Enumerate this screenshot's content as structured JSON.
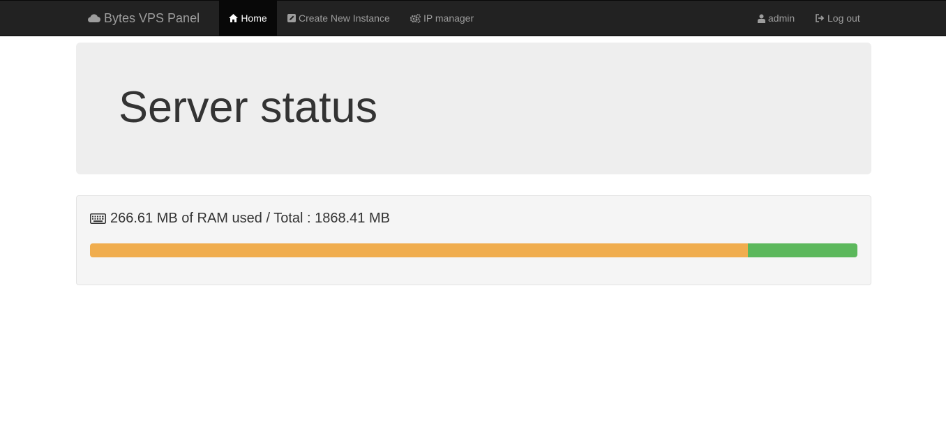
{
  "navbar": {
    "brand": "Bytes VPS Panel",
    "brand_icon": "cloud-icon",
    "items": [
      {
        "label": "Home",
        "icon": "home-icon",
        "active": true
      },
      {
        "label": "Create New Instance",
        "icon": "edit-icon",
        "active": false
      },
      {
        "label": "IP manager",
        "icon": "cogs-icon",
        "active": false
      }
    ],
    "right_items": [
      {
        "label": "admin",
        "icon": "user-icon"
      },
      {
        "label": "Log out",
        "icon": "logout-icon"
      }
    ]
  },
  "jumbotron": {
    "title": "Server status"
  },
  "ram": {
    "icon": "keyboard-icon",
    "text": "266.61 MB of RAM used / Total : 1868.41 MB",
    "progress": {
      "warning_percent": 85.7,
      "success_percent": 14.3,
      "colors": {
        "warning": "#f0ad4e",
        "success": "#5cb85c"
      }
    }
  },
  "colors": {
    "navbar_bg": "#222222",
    "navbar_text": "#9d9d9d",
    "jumbotron_bg": "#eeeeee"
  }
}
